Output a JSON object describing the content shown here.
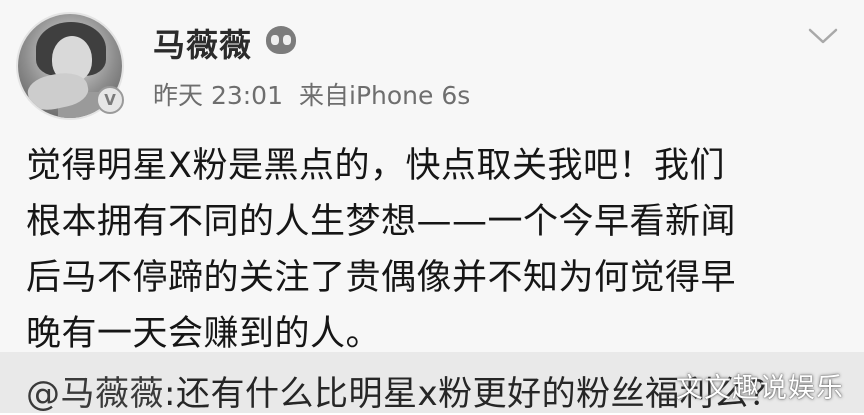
{
  "post": {
    "author": {
      "name": "马薇薇",
      "verified_badge": "V",
      "member_icon": "member-badge-icon"
    },
    "meta": {
      "time": "昨天 23:01",
      "source": "来自iPhone 6s"
    },
    "menu_icon": "chevron-down-icon",
    "content_lines": [
      "觉得明星X粉是黑点的，快点取关我吧！我们",
      "根本拥有不同的人生梦想——一个今早看新闻",
      "后马不停蹄的关注了贵偶像并不知为何觉得早",
      "晚有一天会赚到的人。"
    ]
  },
  "repost": {
    "mention": "@马薇薇",
    "text": ":还有什么比明星x粉更好的粉丝福利么？"
  },
  "watermark": {
    "text": "文文趣说娱乐"
  }
}
